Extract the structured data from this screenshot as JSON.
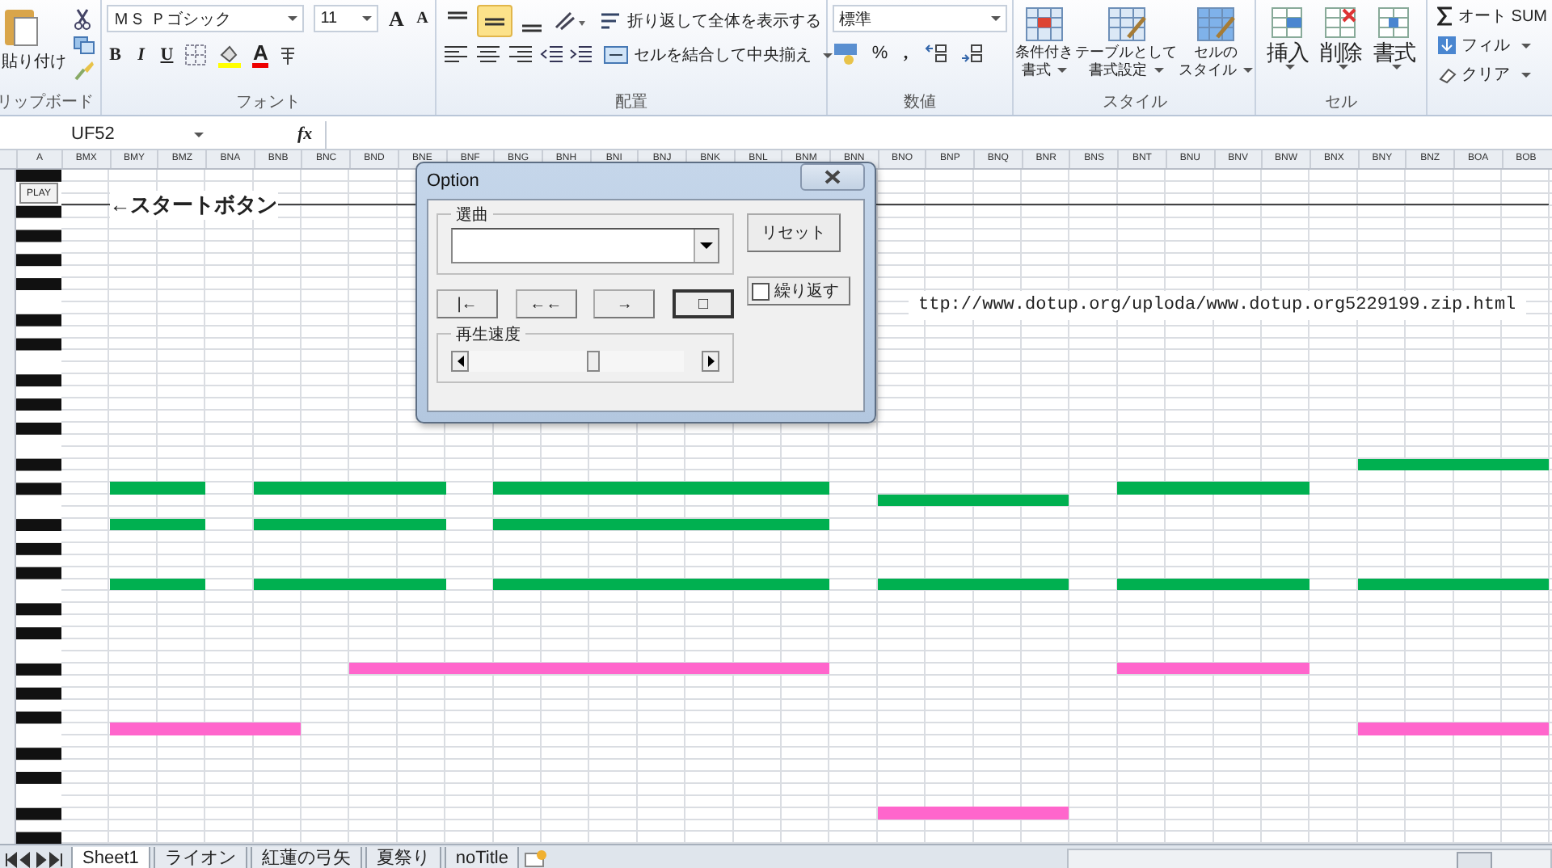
{
  "ribbon": {
    "clipboard": {
      "label": "リップボード",
      "paste": "貼り付け"
    },
    "font": {
      "label": "フォント",
      "name": "ＭＳ Ｐゴシック",
      "size": "11",
      "grow": "A",
      "shrink": "A",
      "bold": "B",
      "italic": "I",
      "underline": "U",
      "color_button": "A"
    },
    "alignment": {
      "label": "配置",
      "vertical": [
        {
          "selected": false
        },
        {
          "selected": true
        },
        {
          "selected": false
        }
      ],
      "wrap": "折り返して全体を表示する",
      "merge": "セルを結合して中央揃え"
    },
    "number": {
      "label": "数値",
      "format": "標準",
      "percent": "%",
      "comma": ","
    },
    "styles": {
      "label": "スタイル",
      "buttons": [
        [
          "条件付き",
          "書式"
        ],
        [
          "テーブルとして",
          "書式設定"
        ],
        [
          "セルの",
          "スタイル"
        ]
      ]
    },
    "cells": {
      "label": "セル",
      "buttons": [
        "挿入",
        "削除",
        "書式"
      ]
    },
    "editing": {
      "items": [
        {
          "kind": "sum",
          "label": "オート SUM"
        },
        {
          "kind": "fill",
          "label": "フィル"
        },
        {
          "kind": "clear",
          "label": "クリア"
        }
      ]
    }
  },
  "formula_bar": {
    "name_box": "UF52",
    "fx": "fx"
  },
  "sheet": {
    "columns": [
      "A",
      "BMX",
      "BMY",
      "BMZ",
      "BNA",
      "BNB",
      "BNC",
      "BND",
      "BNE",
      "BNF",
      "BNG",
      "BNH",
      "BNI",
      "BNJ",
      "BNK",
      "BNL",
      "BNM",
      "BNN",
      "BNO",
      "BNP",
      "BNQ",
      "BNR",
      "BNS",
      "BNT",
      "BNU",
      "BNV",
      "BNW",
      "BNX",
      "BNY",
      "BNZ",
      "BOA",
      "BOB"
    ],
    "play_button": "PLAY",
    "start_label": "←スタートボタン",
    "url": "ttp://www.dotup.org/uploda/www.dotup.org5229199.zip.html",
    "notes": [
      {
        "color": "#00b050"
      },
      {
        "color": "#00b050"
      },
      {
        "color": "#00b050"
      },
      {
        "color": "#00b050"
      },
      {
        "color": "#00b050"
      },
      {
        "color": "#00b050"
      },
      {
        "color": "#00b050"
      },
      {
        "color": "#00b050"
      },
      {
        "color": "#00b050"
      },
      {
        "color": "#00b050"
      },
      {
        "color": "#00b050"
      },
      {
        "color": "#00b050"
      },
      {
        "color": "#00b050"
      },
      {
        "color": "#00b050"
      },
      {
        "color": "#00b050"
      },
      {
        "color": "#ff66cc"
      },
      {
        "color": "#ff66cc"
      },
      {
        "color": "#ff66cc"
      },
      {
        "color": "#ff66cc"
      },
      {
        "color": "#ff66cc"
      }
    ]
  },
  "dialog": {
    "title": "Option",
    "song_frame": "選曲",
    "reset": "リセット",
    "transport": [
      {
        "label": "|←",
        "default": false
      },
      {
        "label": "←←",
        "default": false
      },
      {
        "label": "→",
        "default": false
      },
      {
        "label": "□",
        "default": true
      }
    ],
    "repeat": {
      "label": "繰り返す",
      "checked": false
    },
    "speed_frame": "再生速度"
  },
  "sheet_tabs": [
    {
      "label": "Sheet1",
      "selected": true
    },
    {
      "label": "ライオン",
      "selected": false
    },
    {
      "label": "紅蓮の弓矢",
      "selected": false
    },
    {
      "label": "夏祭り",
      "selected": false
    },
    {
      "label": "noTitle",
      "selected": false
    }
  ]
}
